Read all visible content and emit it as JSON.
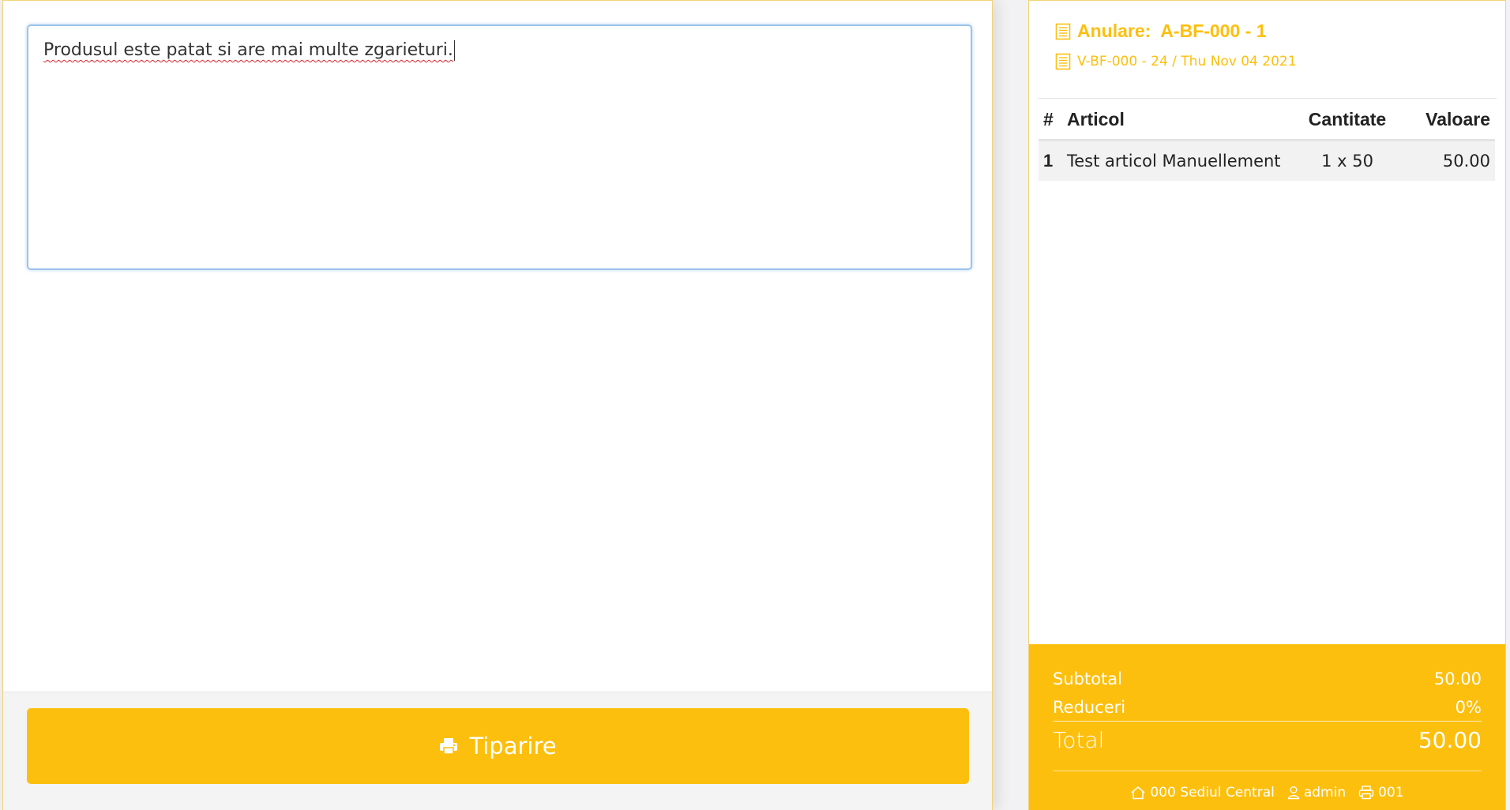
{
  "notes": {
    "value": "Produsul este patat si are mai multe zgarieturi."
  },
  "actions": {
    "print_label": "Tiparire"
  },
  "receipt": {
    "title_prefix": "Anulare:",
    "document_number": "A-BF-000 - 1",
    "source_document": "V-BF-000 - 24 / Thu Nov 04 2021",
    "columns": {
      "num": "#",
      "item": "Articol",
      "qty": "Cantitate",
      "value": "Valoare"
    },
    "items": [
      {
        "num": "1",
        "name": "Test articol Manuellement",
        "qty": "1 x 50",
        "value": "50.00"
      }
    ],
    "totals": {
      "subtotal_label": "Subtotal",
      "subtotal_value": "50.00",
      "discount_label": "Reduceri",
      "discount_value": "0%",
      "total_label": "Total",
      "total_value": "50.00"
    },
    "status": {
      "location": "000 Sediul Central",
      "user": "admin",
      "printer": "001"
    }
  },
  "colors": {
    "accent": "#fdbf0e",
    "focus_border": "#9cc3ea",
    "spellcheck": "#e0242f"
  },
  "icons": {
    "print": "printer-icon",
    "document": "document-icon",
    "location": "home-icon",
    "user": "user-icon",
    "printer_status": "printer-outline-icon"
  }
}
